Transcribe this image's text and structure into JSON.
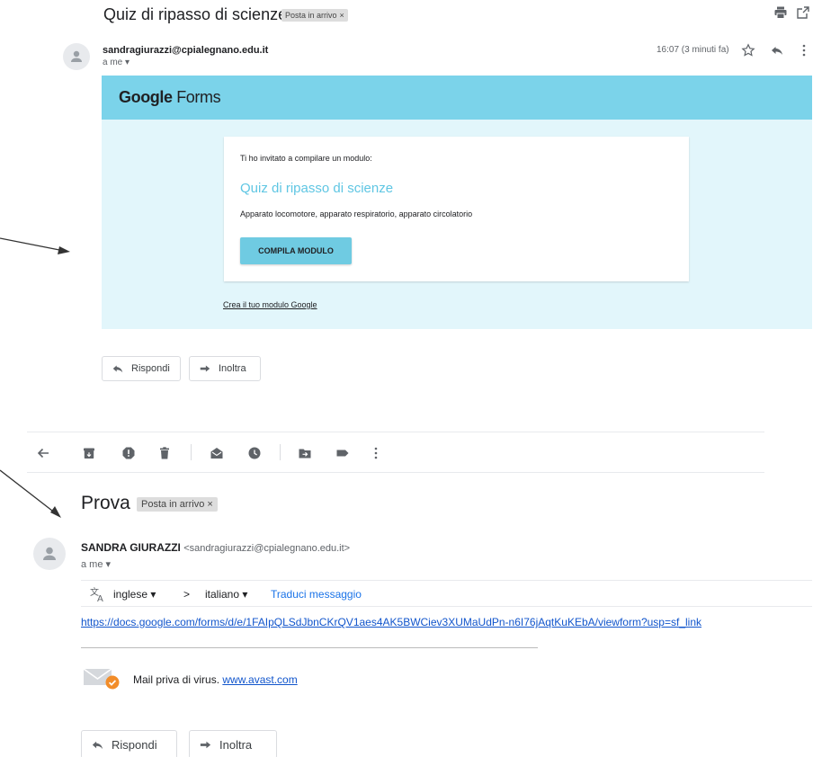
{
  "email1": {
    "subject": "Quiz di ripasso di scienze",
    "label": "Posta in arrivo",
    "label_close": "×",
    "sender": "sandragiurazzi@cpialegnano.edu.it",
    "to_me": "a me ▾",
    "time": "16:07 (3 minuti fa)",
    "form": {
      "logo_bold": "Google",
      "logo_rest": " Forms",
      "invite_text": "Ti ho invitato a compilare un modulo:",
      "title": "Quiz di ripasso di scienze",
      "description": "Apparato locomotore, apparato respiratorio, apparato circolatorio",
      "button": "COMPILA MODULO",
      "create_link": "Crea il tuo modulo Google"
    },
    "reply_label": "Rispondi",
    "forward_label": "Inoltra"
  },
  "email2": {
    "subject": "Prova",
    "label": "Posta in arrivo",
    "label_close": "×",
    "sender_name": "SANDRA GIURAZZI",
    "sender_email": "<sandragiurazzi@cpialegnano.edu.it>",
    "to_me": "a me ▾",
    "translate": {
      "from_lang": "inglese ▾",
      "arrow": ">",
      "to_lang": "italiano ▾",
      "action": "Traduci messaggio"
    },
    "link": "https://docs.google.com/forms/d/e/1FAIpQLSdJbnCKrQV1aes4AK5BWCiev3XUMaUdPn-n6I76jAqtKuKEbA/viewform?usp=sf_link",
    "virus_text": "Mail priva di virus. ",
    "virus_link": "www.avast.com",
    "reply_label": "Rispondi",
    "forward_label": "Inoltra"
  },
  "colors": {
    "forms_header": "#7bd3ea",
    "forms_body": "#e2f6fb",
    "forms_accent": "#5fc6e3",
    "link": "#1155cc"
  },
  "icons": [
    "print-icon",
    "open-in-new-icon",
    "star-icon",
    "reply-icon",
    "more-vert-icon",
    "back-arrow-icon",
    "archive-icon",
    "report-spam-icon",
    "delete-icon",
    "mark-unread-icon",
    "snooze-icon",
    "move-to-icon",
    "label-icon",
    "translate-icon",
    "avast-mail-icon"
  ]
}
